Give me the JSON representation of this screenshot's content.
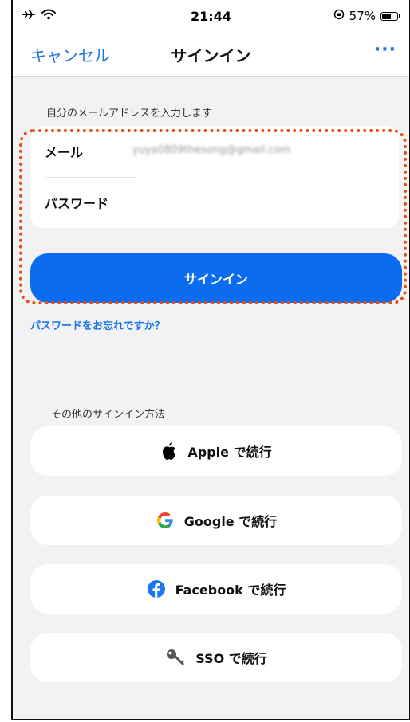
{
  "status_bar": {
    "time": "21:44",
    "battery_text": "57%"
  },
  "nav": {
    "cancel_label": "キャンセル",
    "title": "サインイン",
    "more_label": "···"
  },
  "email_section": {
    "label": "自分のメールアドレスを入力します"
  },
  "form": {
    "email_label": "メール",
    "email_value": "yuya0809thesong@gmail.com",
    "password_label": "パスワード"
  },
  "signin_button_label": "サインイン",
  "forgot_password_label": "パスワードをお忘れですか？",
  "other_methods": {
    "label": "その他のサインイン方法",
    "buttons": [
      {
        "label": "Apple で続行",
        "icon": "apple-icon"
      },
      {
        "label": "Google で続行",
        "icon": "google-icon"
      },
      {
        "label": "Facebook で続行",
        "icon": "facebook-icon"
      },
      {
        "label": "SSO で続行",
        "icon": "key-icon"
      }
    ]
  },
  "colors": {
    "accent": "#1a73e8",
    "primary_button": "#0b6cf0",
    "highlight": "#e84e0f",
    "facebook": "#1877f2"
  }
}
